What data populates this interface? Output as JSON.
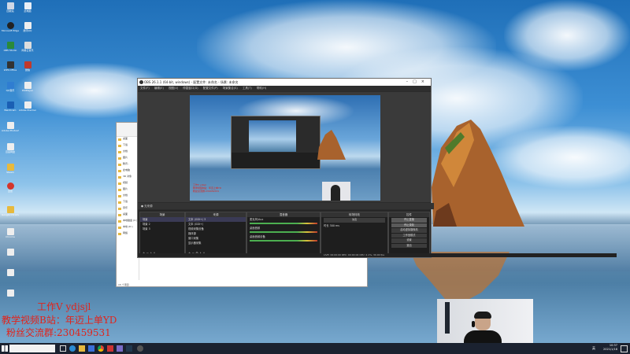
{
  "obs": {
    "title": "OBS 26.1.1 (64-bit, windows) - 配置文件: 未命名 - 场景: 未命名",
    "menu": [
      "文件(F)",
      "编辑(E)",
      "视图(V)",
      "停靠窗口(D)",
      "配置文件(P)",
      "场景集合(S)",
      "工具(T)",
      "帮助(H)"
    ],
    "scene_bar_label": "● 无来源",
    "scenes_header": "场景",
    "scenes": [
      "场景",
      "场景 2",
      "场景 3"
    ],
    "sources_header": "来源",
    "sources": [
      "文本 (GDI+) 3",
      "文本 (GDI+)",
      "视频采集设备",
      "媒体源",
      "窗口采集",
      "显示器采集"
    ],
    "mixer_header": "混音器",
    "mixer": [
      "麦克风/Aux",
      "桌面音频",
      "桌面音频设备"
    ],
    "transitions_header": "转场特效",
    "transition_value": "淡出",
    "duration_label": "时长",
    "duration_value": "300 ms",
    "controls_header": "控件",
    "controls": [
      "停止直播",
      "停止录制",
      "启动虚拟摄像机",
      "工作室模式",
      "设置",
      "退出"
    ],
    "status": "LIVE: 00:00:00   REC: 00:00:04   CPU: 2.1%, 30.00 fps"
  },
  "explorer": {
    "sidebar": [
      "桌面",
      "下载",
      "文档",
      "图片",
      "腾讯..",
      "此电脑",
      "3D 对象",
      "视频",
      "图片",
      "文档",
      "下载",
      "音乐",
      "桌面",
      "本地磁盘 (C:)",
      "本地 (D:)",
      "网络"
    ],
    "status": "15 个项目"
  },
  "desktop_icons": [
    "回收站",
    "此电脑",
    "Microsoft Edge",
    "腾讯QQ",
    "OBS Studio",
    "网易云音乐",
    "WPS Office",
    "微信",
    "QQ音乐",
    "PotPlayer",
    "Bandicam",
    "Adobe Premiere",
    "Adobe Photoshop",
    "百度网盘",
    "Steam",
    "迅雷",
    "Google Chrome",
    "Chrome"
  ],
  "overlay": {
    "line1": "工作V ydjsjl",
    "line2": "教学视频B站：年迈上单YD",
    "line3": "粉丝交流群:230459531"
  },
  "taskbar": {
    "time": "10:37",
    "date": "2021/1/18",
    "lang": "英"
  },
  "colors": {
    "overlay_red": "#e2231a",
    "obs_bg": "#2b2b2b",
    "taskbar": "#1b2230"
  }
}
